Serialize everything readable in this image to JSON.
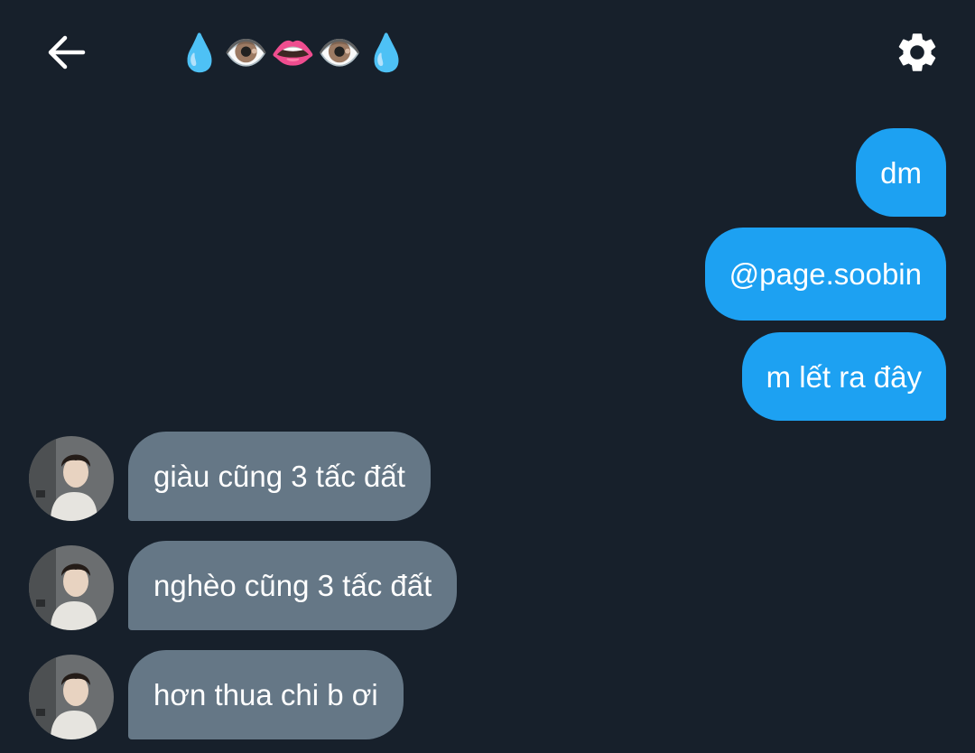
{
  "header": {
    "back_icon": "arrow-left-icon",
    "title": "💧👁️👄👁️💧",
    "settings_icon": "gear-icon"
  },
  "colors": {
    "background": "#17202b",
    "sent_bubble": "#1da1f2",
    "received_bubble": "#657786",
    "text": "#ffffff"
  },
  "messages": {
    "sent": [
      {
        "text": "dm"
      },
      {
        "text": "@page.soobin"
      },
      {
        "text": "m lết ra đây"
      }
    ],
    "received": [
      {
        "text": "giàu cũng 3 tấc đất",
        "avatar": "profile-photo"
      },
      {
        "text": "nghèo cũng 3 tấc đất",
        "avatar": "profile-photo"
      },
      {
        "text": "hơn thua chi b ơi",
        "avatar": "profile-photo"
      }
    ]
  }
}
